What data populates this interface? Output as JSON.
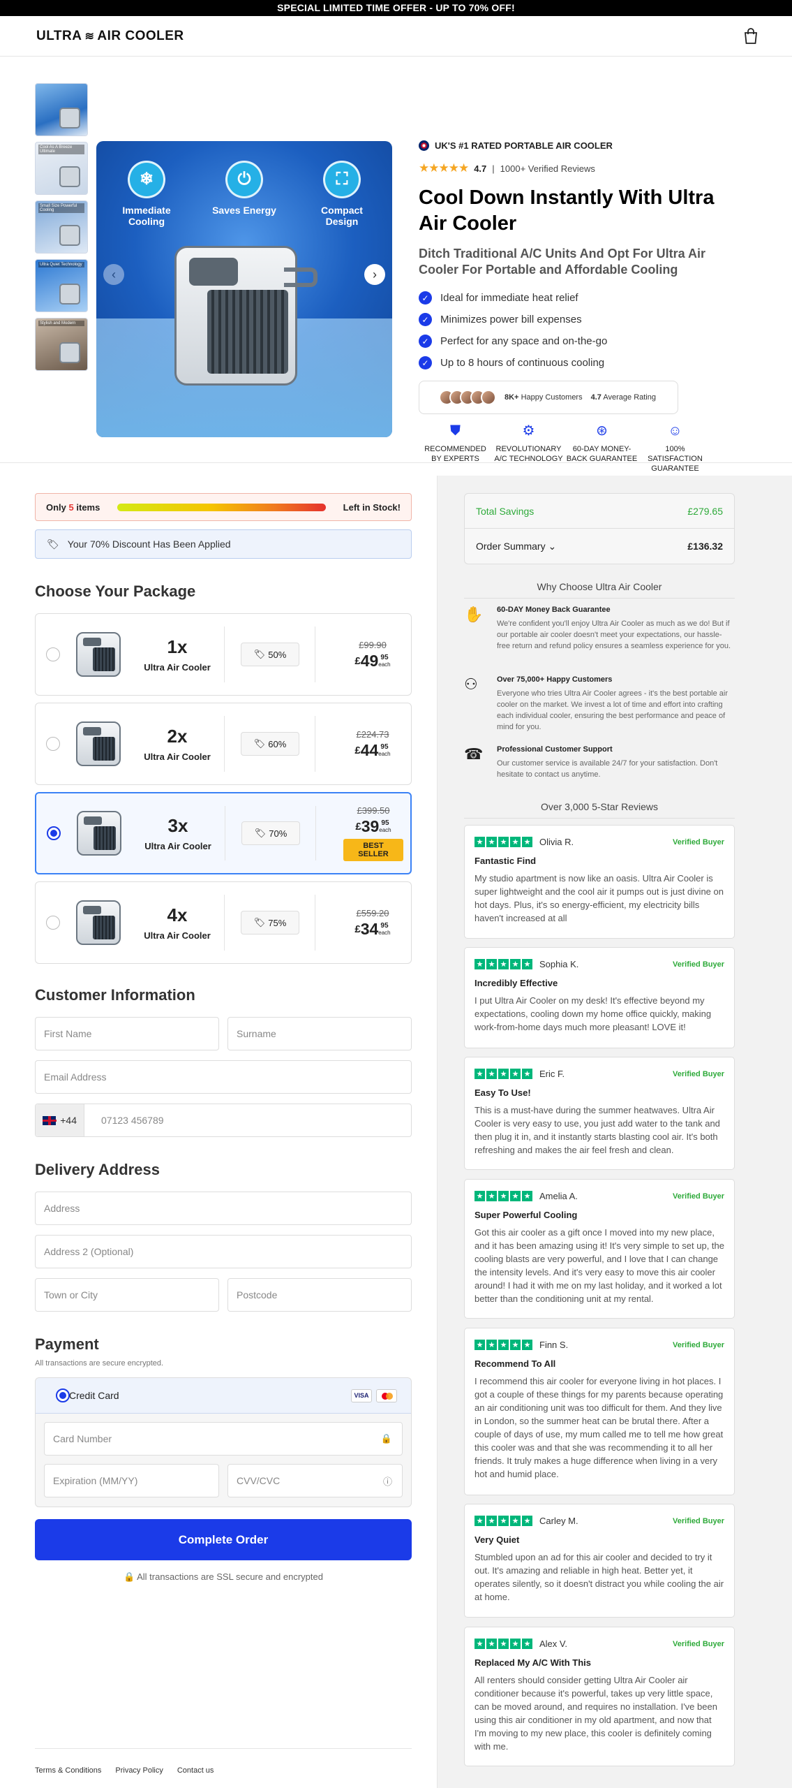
{
  "topbar": "SPECIAL LIMITED TIME OFFER - UP TO 70% OFF!",
  "header": {
    "logo_left": "ULTRA",
    "logo_right": "AIR COOLER"
  },
  "gallery": {
    "thumb_captions": [
      "",
      "Cool As A Breeze Ultimate",
      "Small Size Powerful Cooling",
      "Ultra Quiet Technology",
      "Stylish and Modern"
    ],
    "features": [
      {
        "label": "Immediate Cooling",
        "icon": "thermometer-icon"
      },
      {
        "label": "Saves Energy",
        "icon": "plug-icon"
      },
      {
        "label": "Compact Design",
        "icon": "compact-icon"
      }
    ],
    "prev": "‹",
    "next": "›"
  },
  "product": {
    "rated": "UK'S #1 RATED PORTABLE AIR COOLER",
    "stars": "★★★★★",
    "rating": "4.7",
    "reviews_count": "1000+ Verified Reviews",
    "title": "Cool Down Instantly With Ultra Air Cooler",
    "subtitle": "Ditch Traditional A/C Units And Opt For Ultra Air Cooler For Portable and Affordable Cooling",
    "bullets": [
      "Ideal for immediate heat relief",
      "Minimizes power bill expenses",
      "Perfect for any space and on-the-go",
      "Up to 8 hours of continuous cooling"
    ],
    "social": {
      "customers": "8K+",
      "customers_label": "Happy Customers",
      "avg": "4.7",
      "avg_label": "Average Rating"
    },
    "trust": [
      "RECOMMENDED BY EXPERTS",
      "REVOLUTIONARY A/C TECHNOLOGY",
      "60-DAY MONEY-BACK GUARANTEE",
      "100% SATISFACTION GUARANTEE"
    ]
  },
  "checkout": {
    "stock_prefix": "Only",
    "stock_count": "5",
    "stock_unit": "items",
    "stock_suffix": "Left in Stock!",
    "discount_note": "Your 70% Discount Has Been Applied",
    "choose_title": "Choose Your Package",
    "packages": [
      {
        "qty": "1x",
        "name": "Ultra Air Cooler",
        "off": "50%",
        "old": "£99.90",
        "whole": "49",
        "dec": "95",
        "each": "each",
        "badge": "",
        "selected": false
      },
      {
        "qty": "2x",
        "name": "Ultra Air Cooler",
        "off": "60%",
        "old": "£224.73",
        "whole": "44",
        "dec": "95",
        "each": "each",
        "badge": "",
        "selected": false
      },
      {
        "qty": "3x",
        "name": "Ultra Air Cooler",
        "off": "70%",
        "old": "£399.50",
        "whole": "39",
        "dec": "95",
        "each": "each",
        "badge": "BEST SELLER",
        "selected": true
      },
      {
        "qty": "4x",
        "name": "Ultra Air Cooler",
        "off": "75%",
        "old": "£559.20",
        "whole": "34",
        "dec": "95",
        "each": "each",
        "badge": "",
        "selected": false
      }
    ],
    "currency": "£",
    "customer_title": "Customer Information",
    "first_name": "First Name",
    "surname": "Surname",
    "email": "Email Address",
    "phone_code": "+44",
    "phone_placeholder": "07123 456789",
    "delivery_title": "Delivery Address",
    "address": "Address",
    "address2": "Address 2 (Optional)",
    "town": "Town or City",
    "postcode": "Postcode",
    "payment_title": "Payment",
    "payment_note": "All transactions are secure encrypted.",
    "credit_card": "Credit Card",
    "visa": "VISA",
    "card_number": "Card Number",
    "expiry": "Expiration (MM/YY)",
    "cvv": "CVV/CVC",
    "cta": "Complete Order",
    "secure": "All transactions are SSL secure and encrypted"
  },
  "footer": [
    "Terms & Conditions",
    "Privacy Policy",
    "Contact us"
  ],
  "summary": {
    "savings_label": "Total Savings",
    "savings_value": "£279.65",
    "order_label": "Order Summary",
    "order_value": "£136.32"
  },
  "why": {
    "title": "Why Choose Ultra Air Cooler",
    "items": [
      {
        "title": "60-DAY Money Back Guarantee",
        "text": "We're confident you'll enjoy Ultra Air Cooler as much as we do! But if our portable air cooler doesn't meet your expectations, our hassle-free return and refund policy ensures a seamless experience for you."
      },
      {
        "title": "Over 75,000+ Happy Customers",
        "text": "Everyone who tries Ultra Air Cooler agrees - it's the best portable air cooler on the market. We invest a lot of time and effort into crafting each individual cooler, ensuring the best performance and peace of mind for you."
      },
      {
        "title": "Professional Customer Support",
        "text": "Our customer service is available 24/7 for your satisfaction. Don't hesitate to contact us anytime."
      }
    ]
  },
  "reviews": {
    "title": "Over 3,000 5-Star Reviews",
    "verified": "Verified Buyer",
    "items": [
      {
        "name": "Olivia R.",
        "title": "Fantastic Find",
        "text": "My studio apartment is now like an oasis. Ultra Air Cooler is super lightweight and the cool air it pumps out is just divine on hot days. Plus, it's so energy-efficient, my electricity bills haven't increased at all"
      },
      {
        "name": "Sophia K.",
        "title": "Incredibly Effective",
        "text": "I put Ultra Air Cooler on my desk! It's effective beyond my expectations, cooling down my home office quickly, making work-from-home days much more pleasant! LOVE it!"
      },
      {
        "name": "Eric F.",
        "title": "Easy To Use!",
        "text": "This is a must-have during the summer heatwaves. Ultra Air Cooler is very easy to use, you just add water to the tank and then plug it in, and it instantly starts blasting cool air. It's both refreshing and makes the air feel fresh and clean."
      },
      {
        "name": "Amelia A.",
        "title": "Super Powerful Cooling",
        "text": "Got this air cooler as a gift once I moved into my new place, and it has been amazing using it! It's very simple to set up, the cooling blasts are very powerful, and I love that I can change the intensity levels. And it's very easy to move this air cooler around! I had it with me on my last holiday, and it worked a lot better than the conditioning unit at my rental."
      },
      {
        "name": "Finn S.",
        "title": "Recommend To All",
        "text": "I recommend this air cooler for everyone living in hot places. I got a couple of these things for my parents because operating an air conditioning unit was too difficult for them. And they live in London, so the summer heat can be brutal there. After a couple of days of use, my mum called me to tell me how great this cooler was and that she was recommending it to all her friends. It truly makes a huge difference when living in a very hot and humid place."
      },
      {
        "name": "Carley M.",
        "title": "Very Quiet",
        "text": "Stumbled upon an ad for this air cooler and decided to try it out. It's amazing and reliable in high heat. Better yet, it operates silently, so it doesn't distract you while cooling the air at home."
      },
      {
        "name": "Alex V.",
        "title": "Replaced My A/C With This",
        "text": "All renters should consider getting Ultra Air Cooler air conditioner because it's powerful, takes up very little space, can be moved around, and requires no installation. I've been using this air conditioner in my old apartment, and now that I'm moving to my new place, this cooler is definitely coming with me."
      }
    ]
  }
}
